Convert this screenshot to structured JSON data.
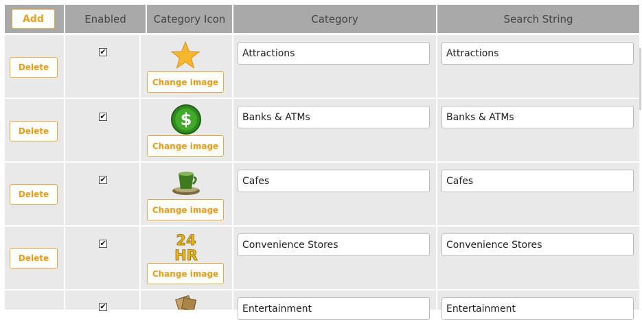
{
  "header": {
    "add_label": "Add",
    "columns": [
      "Enabled",
      "Category Icon",
      "Category",
      "Search String"
    ]
  },
  "rows": [
    {
      "delete_label": "Delete",
      "enabled": true,
      "icon": "star-icon",
      "change_label": "Change image",
      "category": "Attractions",
      "search": "Attractions"
    },
    {
      "delete_label": "Delete",
      "enabled": true,
      "icon": "dollar-icon",
      "change_label": "Change image",
      "category": "Banks & ATMs",
      "search": "Banks & ATMs"
    },
    {
      "delete_label": "Delete",
      "enabled": true,
      "icon": "coffee-cup-icon",
      "change_label": "Change image",
      "category": "Cafes",
      "search": "Cafes"
    },
    {
      "delete_label": "Delete",
      "enabled": true,
      "icon": "24hr-icon",
      "change_label": "Change image",
      "category": "Convenience Stores",
      "search": "Convenience Stores"
    },
    {
      "delete_label": "",
      "enabled": true,
      "icon": "tickets-icon",
      "change_label": "",
      "category": "Entertainment",
      "search": "Entertainment"
    }
  ],
  "colors": {
    "accent": "#e8a21e",
    "header_bg": "#a9a9a9",
    "row_bg": "#e9e9e9"
  }
}
